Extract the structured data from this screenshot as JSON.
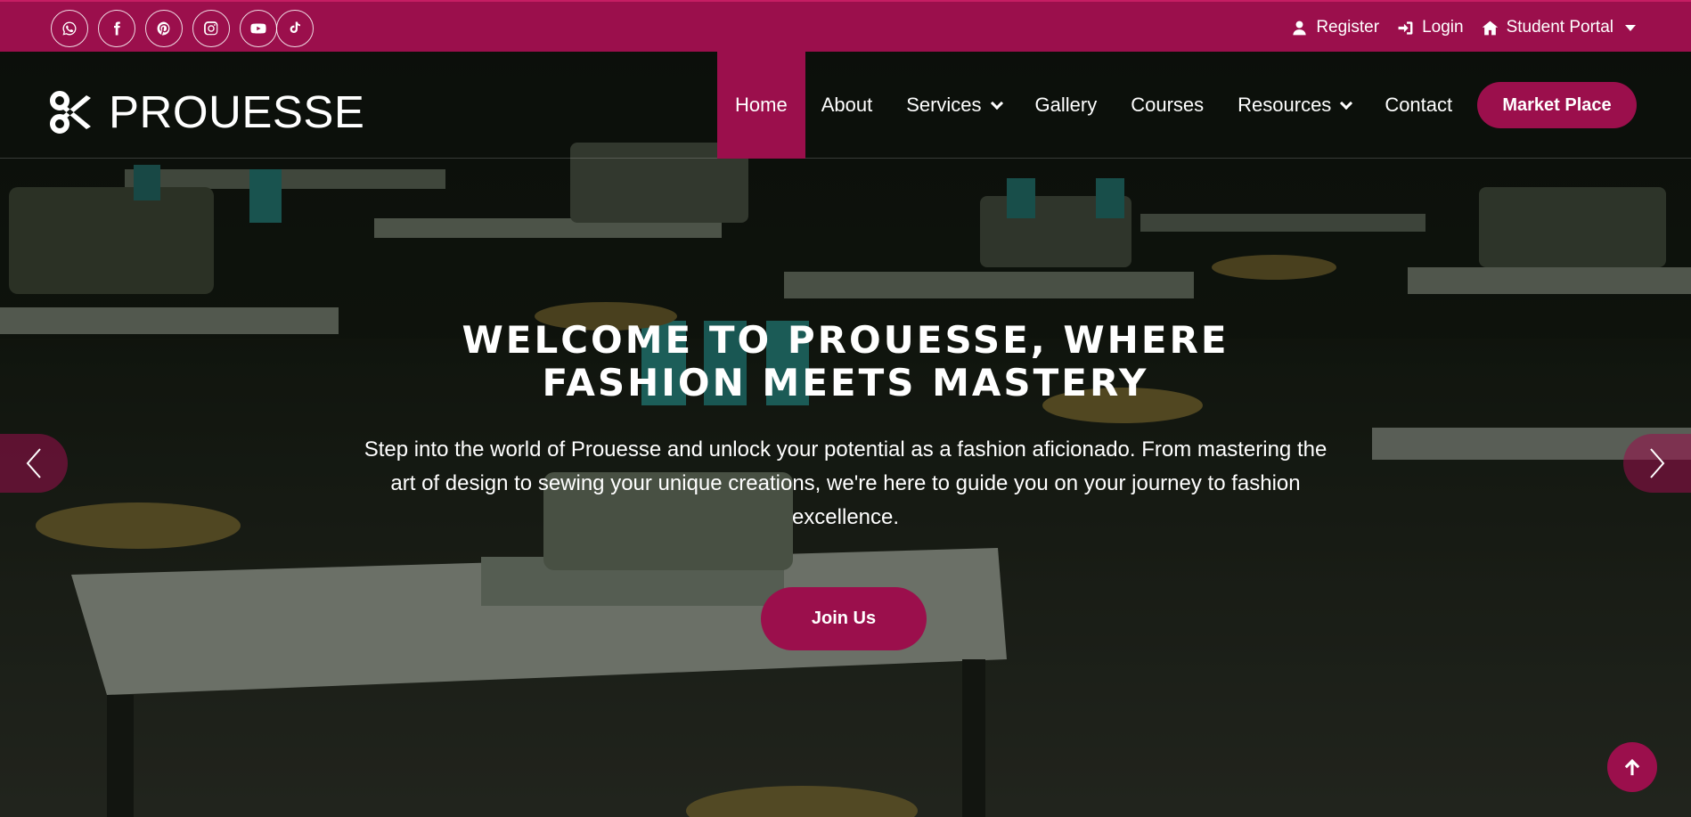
{
  "colors": {
    "brand": "#9b0f4c",
    "text": "#ffffff"
  },
  "topbar": {
    "social": [
      {
        "icon": "whatsapp-icon"
      },
      {
        "icon": "facebook-icon"
      },
      {
        "icon": "pinterest-icon"
      },
      {
        "icon": "instagram-icon"
      },
      {
        "icon": "youtube-icon"
      },
      {
        "icon": "tiktok-icon"
      }
    ],
    "register_label": "Register",
    "login_label": "Login",
    "portal_label": "Student Portal"
  },
  "nav": {
    "brand": "PROUESSE",
    "items": [
      {
        "label": "Home",
        "active": true
      },
      {
        "label": "About"
      },
      {
        "label": "Services",
        "dropdown": true
      },
      {
        "label": "Gallery"
      },
      {
        "label": "Courses"
      },
      {
        "label": "Resources",
        "dropdown": true
      },
      {
        "label": "Contact"
      }
    ],
    "market_label": "Market Place"
  },
  "hero": {
    "title": "WELCOME TO PROUESSE, WHERE FASHION MEETS MASTERY",
    "text": "Step into the world of Prouesse and unlock your potential as a fashion aficionado. From mastering the art of design to sewing your unique creations, we're here to guide you on your journey to fashion excellence.",
    "cta_label": "Join Us"
  }
}
